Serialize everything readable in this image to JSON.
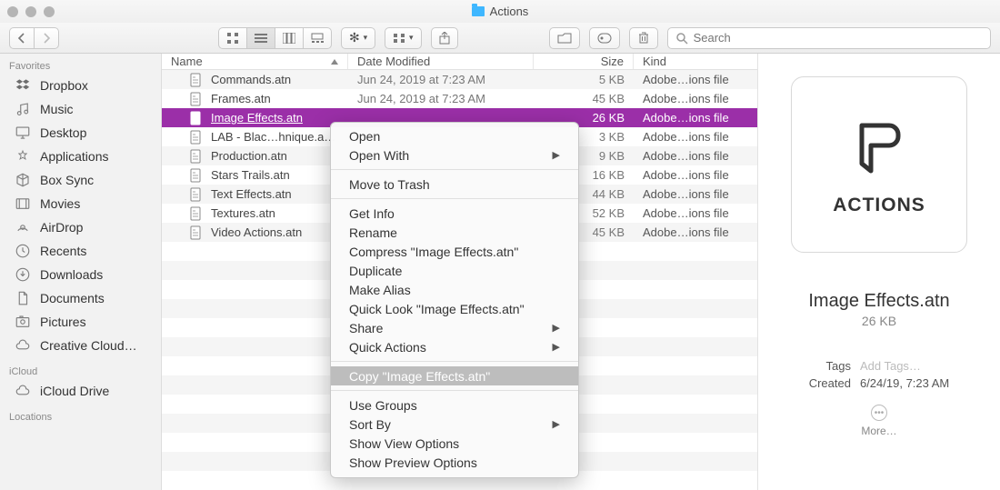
{
  "window": {
    "title": "Actions"
  },
  "search": {
    "placeholder": "Search"
  },
  "sidebar": {
    "sections": [
      {
        "label": "Favorites",
        "items": [
          {
            "label": "Dropbox"
          },
          {
            "label": "Music"
          },
          {
            "label": "Desktop"
          },
          {
            "label": "Applications"
          },
          {
            "label": "Box Sync"
          },
          {
            "label": "Movies"
          },
          {
            "label": "AirDrop"
          },
          {
            "label": "Recents"
          },
          {
            "label": "Downloads"
          },
          {
            "label": "Documents"
          },
          {
            "label": "Pictures"
          },
          {
            "label": "Creative Cloud…"
          }
        ]
      },
      {
        "label": "iCloud",
        "items": [
          {
            "label": "iCloud Drive"
          }
        ]
      },
      {
        "label": "Locations",
        "items": []
      }
    ]
  },
  "columns": {
    "name": "Name",
    "date": "Date Modified",
    "size": "Size",
    "kind": "Kind"
  },
  "files": [
    {
      "name": "Commands.atn",
      "date": "Jun 24, 2019 at 7:23 AM",
      "size": "5 KB",
      "kind": "Adobe…ions file",
      "selected": false
    },
    {
      "name": "Frames.atn",
      "date": "Jun 24, 2019 at 7:23 AM",
      "size": "45 KB",
      "kind": "Adobe…ions file",
      "selected": false
    },
    {
      "name": "Image Effects.atn",
      "date": "",
      "size": "26 KB",
      "kind": "Adobe…ions file",
      "selected": true
    },
    {
      "name": "LAB - Blac…hnique.a…",
      "date": "",
      "size": "3 KB",
      "kind": "Adobe…ions file",
      "selected": false
    },
    {
      "name": "Production.atn",
      "date": "",
      "size": "9 KB",
      "kind": "Adobe…ions file",
      "selected": false
    },
    {
      "name": "Stars Trails.atn",
      "date": "",
      "size": "16 KB",
      "kind": "Adobe…ions file",
      "selected": false
    },
    {
      "name": "Text Effects.atn",
      "date": "",
      "size": "44 KB",
      "kind": "Adobe…ions file",
      "selected": false
    },
    {
      "name": "Textures.atn",
      "date": "",
      "size": "52 KB",
      "kind": "Adobe…ions file",
      "selected": false
    },
    {
      "name": "Video Actions.atn",
      "date": "",
      "size": "45 KB",
      "kind": "Adobe…ions file",
      "selected": false
    }
  ],
  "contextmenu": {
    "open": "Open",
    "open_with": "Open With",
    "trash": "Move to Trash",
    "get_info": "Get Info",
    "rename": "Rename",
    "compress": "Compress \"Image Effects.atn\"",
    "duplicate": "Duplicate",
    "alias": "Make Alias",
    "quicklook": "Quick Look \"Image Effects.atn\"",
    "share": "Share",
    "quickactions": "Quick Actions",
    "copy": "Copy \"Image Effects.atn\"",
    "groups": "Use Groups",
    "sortby": "Sort By",
    "viewopts": "Show View Options",
    "previewopts": "Show Preview Options"
  },
  "preview": {
    "badge": "ACTIONS",
    "title": "Image Effects.atn",
    "size": "26 KB",
    "tags_label": "Tags",
    "tags_placeholder": "Add Tags…",
    "created_label": "Created",
    "created_value": "6/24/19, 7:23 AM",
    "more": "More…"
  }
}
